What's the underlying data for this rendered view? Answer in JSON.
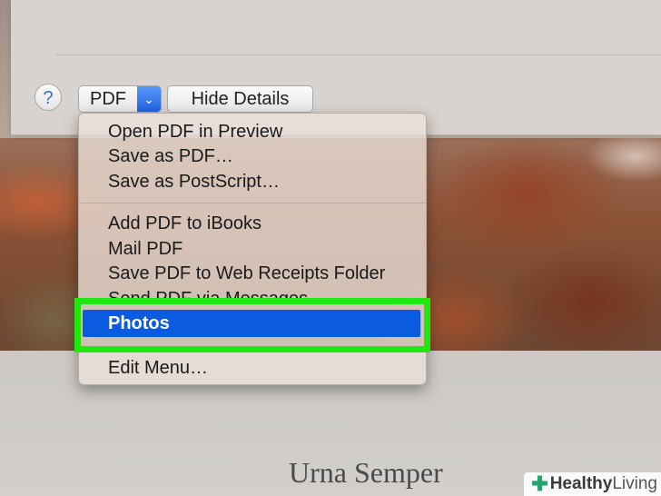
{
  "dialog": {
    "help_label": "?",
    "pdf_button_label": "PDF",
    "pdf_arrow": "⌄",
    "hide_details_label": "Hide Details"
  },
  "menu": {
    "group1": [
      "Open PDF in Preview",
      "Save as PDF…",
      "Save as PostScript…"
    ],
    "group2": [
      "Add PDF to iBooks",
      "Mail PDF",
      "Save PDF to Web Receipts Folder",
      "Send PDF via Messages"
    ],
    "selected": "Photos",
    "group3": [
      "Edit Menu…"
    ]
  },
  "document": {
    "title": "Urna Semper"
  },
  "watermark": {
    "brand_first": "Healthy",
    "brand_second": "Living"
  },
  "colors": {
    "selection": "#0b5be0",
    "highlight_box": "#22e60e"
  }
}
